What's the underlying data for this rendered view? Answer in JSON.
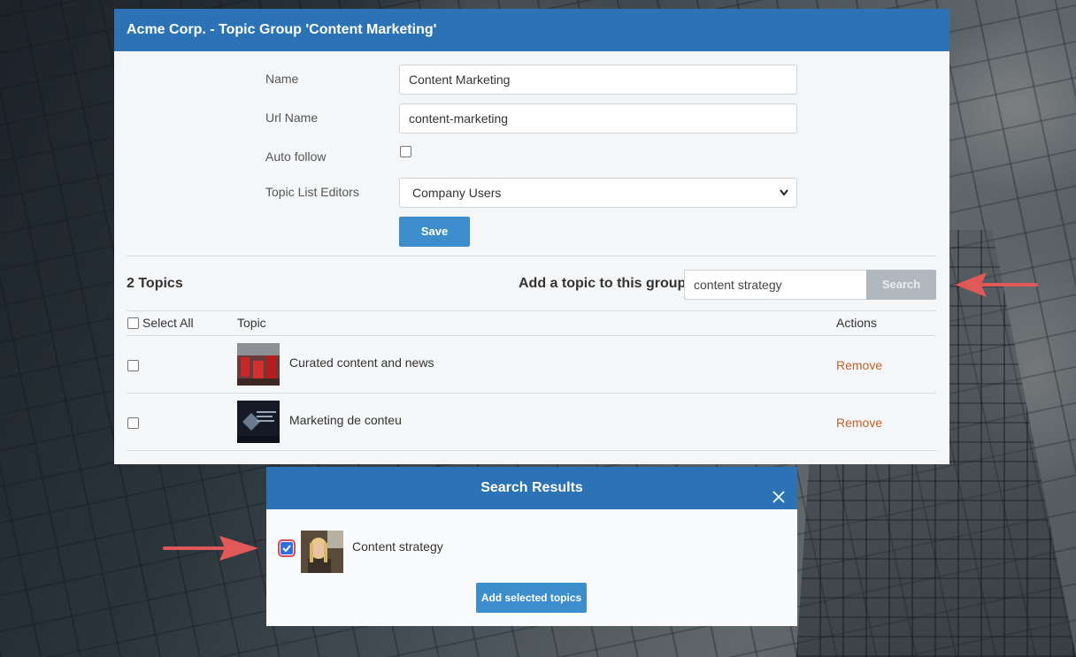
{
  "panel": {
    "title": "Acme Corp. - Topic Group 'Content Marketing'",
    "form": {
      "name_label": "Name",
      "name_value": "Content Marketing",
      "url_label": "Url Name",
      "url_value": "content-marketing",
      "auto_follow_label": "Auto follow",
      "auto_follow_checked": false,
      "editors_label": "Topic List Editors",
      "editors_value": "Company Users",
      "save_label": "Save"
    },
    "topics": {
      "count_label": "2 Topics",
      "add_label": "Add a topic to this group",
      "search_value": "content strategy",
      "search_button": "Search",
      "columns": {
        "select_all": "Select All",
        "topic": "Topic",
        "actions": "Actions"
      },
      "rows": [
        {
          "title": "Curated content and news",
          "action": "Remove"
        },
        {
          "title": "Marketing de conteu",
          "action": "Remove"
        }
      ]
    }
  },
  "modal": {
    "title": "Search Results",
    "result_title": "Content strategy",
    "result_checked": true,
    "add_button": "Add selected topics"
  },
  "colors": {
    "header_blue": "#2c73b5",
    "button_blue": "#3c8dcc",
    "remove_link": "#c0612b",
    "annotation_arrow": "#e05858"
  }
}
